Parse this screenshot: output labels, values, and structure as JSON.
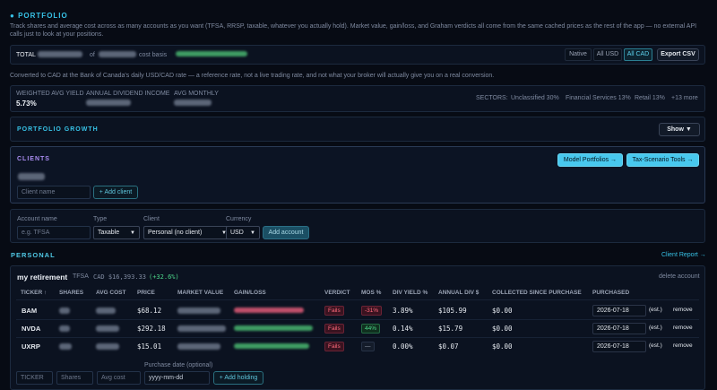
{
  "portfolio": {
    "title": "PORTFOLIO",
    "description": "Track shares and average cost across as many accounts as you want (TFSA, RRSP, taxable, whatever you actually hold). Market value, gain/loss, and Graham verdicts all come from the same cached prices as the rest of the app — no external API calls just to look at your positions."
  },
  "total_bar": {
    "label": "TOTAL",
    "of_text": "of",
    "cost_basis": "cost basis",
    "view_modes": [
      "Native",
      "All USD",
      "All CAD"
    ],
    "active_mode": "All CAD",
    "export_label": "Export CSV"
  },
  "fx_note": "Converted to CAD at the Bank of Canada's daily USD/CAD rate — a reference rate, not a live trading rate, and not what your broker will actually give you on a real conversion.",
  "stats": {
    "yield_label": "WEIGHTED AVG YIELD",
    "yield_value": "5.73%",
    "income_label": "ANNUAL DIVIDEND INCOME",
    "monthly_label": "AVG MONTHLY",
    "sectors_label": "SECTORS:",
    "sectors": [
      "Unclassified 30%",
      "Financial Services 13%",
      "Retail 13%",
      "+13 more"
    ]
  },
  "growth": {
    "title": "PORTFOLIO GROWTH",
    "toggle": "Show ▼"
  },
  "clients": {
    "title": "CLIENTS",
    "model_btn": "Model Portfolios →",
    "tax_btn": "Tax-Scenario Tools →",
    "name_placeholder": "Client name",
    "add_btn": "+ Add client"
  },
  "account_form": {
    "name_label": "Account name",
    "name_placeholder": "e.g. TFSA",
    "type_label": "Type",
    "type_value": "Taxable",
    "client_label": "Client",
    "client_value": "Personal (no client)",
    "currency_label": "Currency",
    "currency_value": "USD",
    "add_btn": "Add account"
  },
  "section": {
    "title": "PERSONAL",
    "report_link": "Client Report →"
  },
  "account": {
    "name": "my retirement",
    "type": "TFSA",
    "value": "CAD $16,393.33",
    "change": "(+32.6%)",
    "delete": "delete account"
  },
  "table": {
    "headers": [
      "TICKER ↑",
      "SHARES",
      "AVG COST",
      "PRICE",
      "MARKET VALUE",
      "GAIN/LOSS",
      "VERDICT",
      "MOS %",
      "DIV YIELD %",
      "ANNUAL DIV $",
      "COLLECTED SINCE PURCHASE",
      "PURCHASED"
    ],
    "rows": [
      {
        "ticker": "BAM",
        "price": "$68.12",
        "verdict": "Fails",
        "mos": "-31%",
        "div_yield": "3.89%",
        "annual_div": "$105.99",
        "collected": "$0.00",
        "purchased": "2026-07-18",
        "est": "(est.)",
        "remove": "remove"
      },
      {
        "ticker": "NVDA",
        "price": "$292.18",
        "verdict": "Fails",
        "mos": "44%",
        "div_yield": "0.14%",
        "annual_div": "$15.79",
        "collected": "$0.00",
        "purchased": "2026-07-18",
        "est": "(est.)",
        "remove": "remove"
      },
      {
        "ticker": "UXRP",
        "price": "$15.01",
        "verdict": "Fails",
        "mos": "—",
        "div_yield": "0.00%",
        "annual_div": "$0.07",
        "collected": "$0.00",
        "purchased": "2026-07-18",
        "est": "(est.)",
        "remove": "remove"
      }
    ]
  },
  "holding_form": {
    "ticker_placeholder": "TICKER",
    "shares_placeholder": "Shares",
    "avg_placeholder": "Avg cost",
    "date_label": "Purchase date (optional)",
    "date_placeholder": "yyyy-mm-dd",
    "add_btn": "+ Add holding"
  },
  "colors": {
    "accent": "#37c2e6",
    "fail": "#ff6a7c",
    "gain": "#4cd58a",
    "clients_accent": "#a98cf0"
  }
}
